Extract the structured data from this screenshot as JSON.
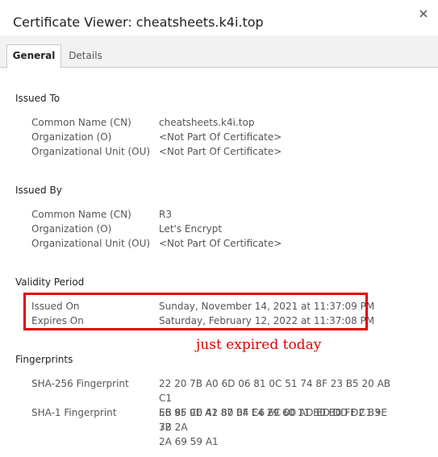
{
  "window": {
    "title": "Certificate Viewer: cheatsheets.k4i.top"
  },
  "tabs": [
    {
      "label": "General",
      "active": true
    },
    {
      "label": "Details",
      "active": false
    }
  ],
  "sections": {
    "issued_to": {
      "heading": "Issued To",
      "rows": [
        {
          "label": "Common Name (CN)",
          "value": "cheatsheets.k4i.top"
        },
        {
          "label": "Organization (O)",
          "value": "<Not Part Of Certificate>"
        },
        {
          "label": "Organizational Unit (OU)",
          "value": "<Not Part Of Certificate>"
        }
      ]
    },
    "issued_by": {
      "heading": "Issued By",
      "rows": [
        {
          "label": "Common Name (CN)",
          "value": "R3"
        },
        {
          "label": "Organization (O)",
          "value": "Let's Encrypt"
        },
        {
          "label": "Organizational Unit (OU)",
          "value": "<Not Part Of Certificate>"
        }
      ]
    },
    "validity": {
      "heading": "Validity Period",
      "rows": [
        {
          "label": "Issued On",
          "value": "Sunday, November 14, 2021 at 11:37:09 PM"
        },
        {
          "label": "Expires On",
          "value": "Saturday, February 12, 2022 at 11:37:08 PM"
        }
      ]
    },
    "fingerprints": {
      "heading": "Fingerprints",
      "rows": [
        {
          "label": "SHA-256 Fingerprint",
          "value_line1": "22 20 7B A0 6D 06 81 0C 51 74 8F 23 B5 20 AB C1",
          "value_line2": "EB 8F 9E A1 87 BF E4 29 60 11 B0 B0 FF C1 9E 72"
        },
        {
          "label": "SHA-1 Fingerprint",
          "value_line1": "56 95 C0 42 80 04 C6 6C 00 AD ED DD D2 B3 3B 2A",
          "value_line2": "2A 69 59 A1"
        }
      ]
    }
  },
  "annotation": {
    "text": "just expired today",
    "color": "#e00000"
  },
  "icons": {
    "close": "close-icon"
  }
}
